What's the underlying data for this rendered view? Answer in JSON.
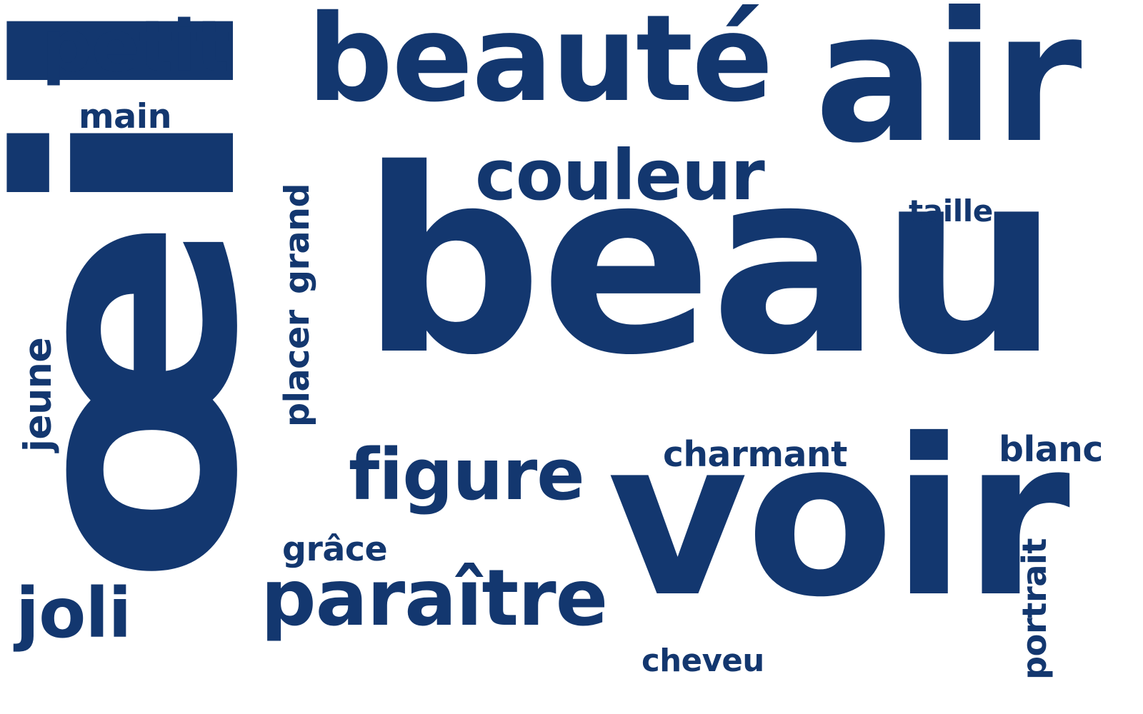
{
  "color": "#13376f",
  "words": [
    {
      "text": "beau"
    },
    {
      "text": "œil"
    },
    {
      "text": "voir"
    },
    {
      "text": "air"
    },
    {
      "text": "beauté"
    },
    {
      "text": "couleur"
    },
    {
      "text": "figure"
    },
    {
      "text": "paraître"
    },
    {
      "text": "petit"
    },
    {
      "text": "main"
    },
    {
      "text": "joli"
    },
    {
      "text": "jeune"
    },
    {
      "text": "placer"
    },
    {
      "text": "grand"
    },
    {
      "text": "grâce"
    },
    {
      "text": "charmant"
    },
    {
      "text": "blanc"
    },
    {
      "text": "taille"
    },
    {
      "text": "cheveu"
    },
    {
      "text": "portrait"
    }
  ]
}
